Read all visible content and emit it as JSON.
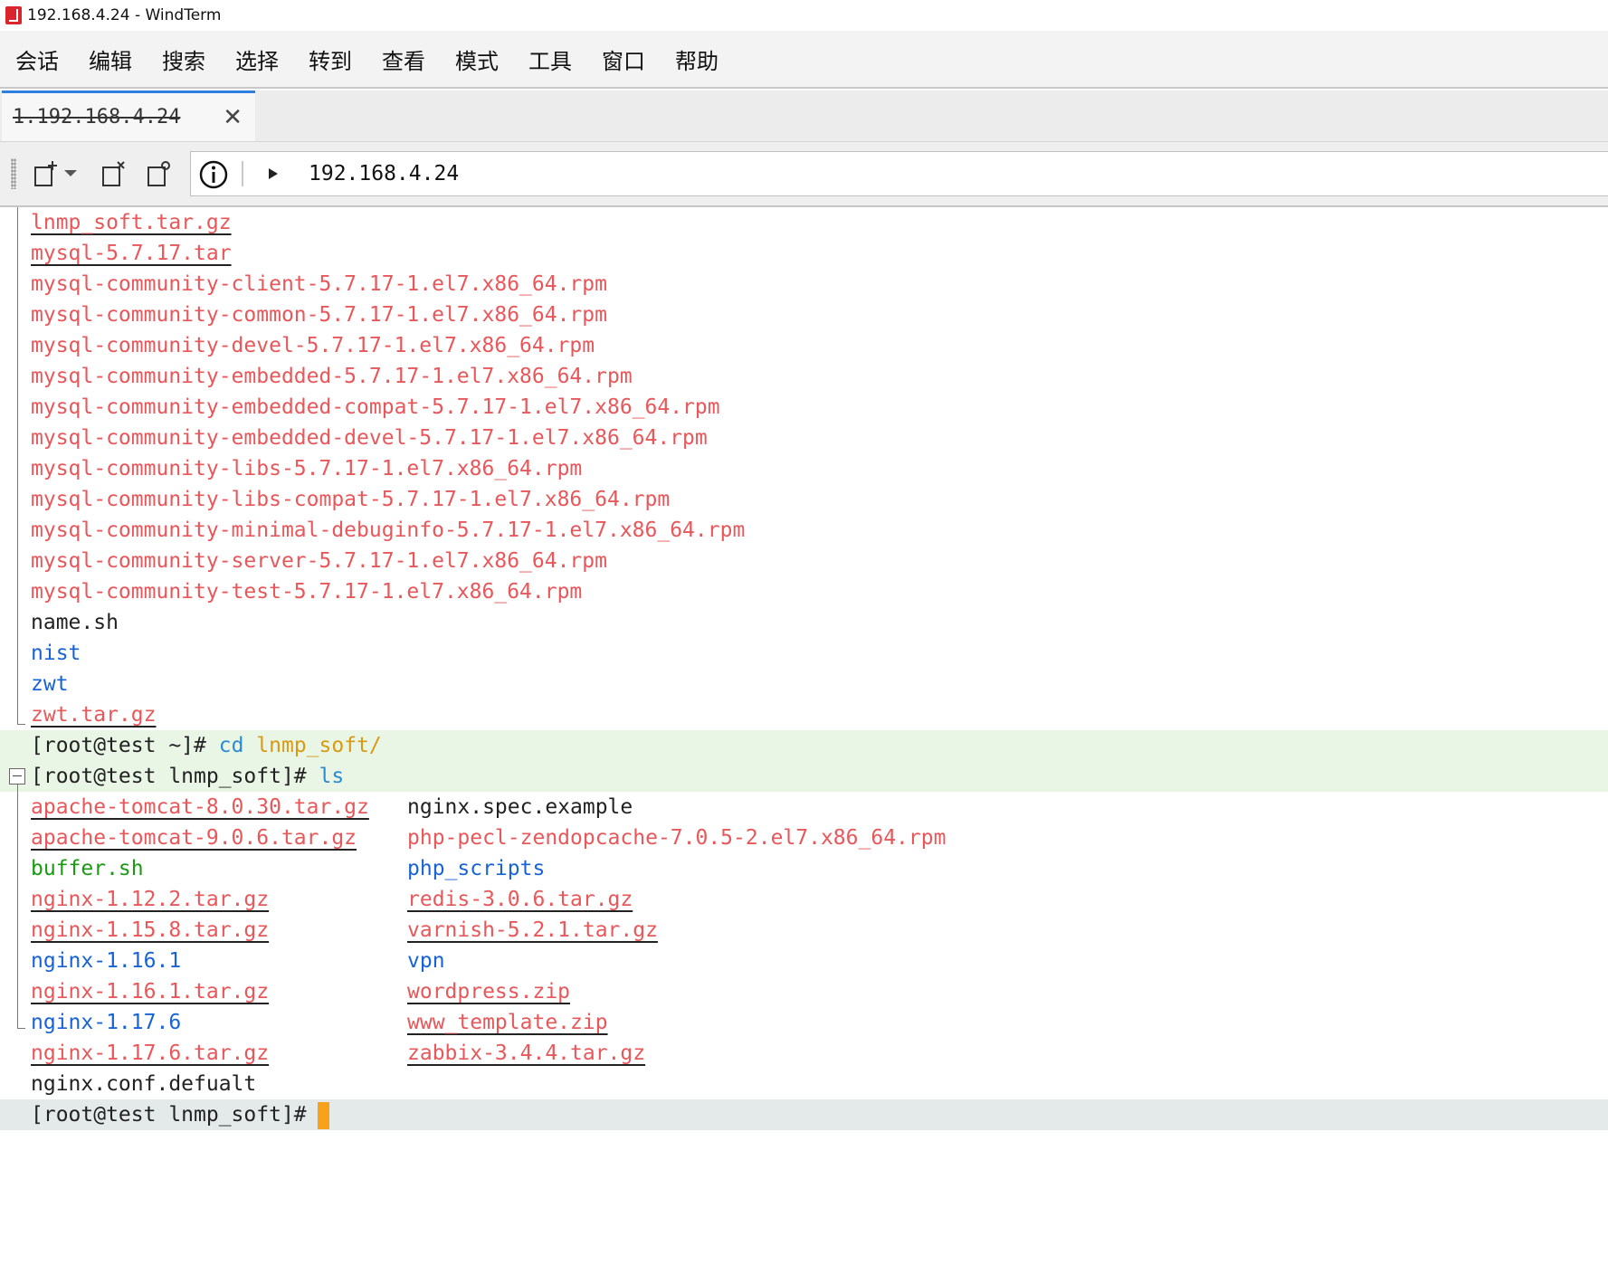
{
  "window": {
    "title": "192.168.4.24 - WindTerm"
  },
  "menu": [
    "会话",
    "编辑",
    "搜索",
    "选择",
    "转到",
    "查看",
    "模式",
    "工具",
    "窗口",
    "帮助"
  ],
  "tab": {
    "label": "1.192.168.4.24"
  },
  "toolbar": {
    "address": "192.168.4.24"
  },
  "icons": [
    "new-session-icon",
    "dropdown-arrow-icon",
    "close-session-icon",
    "session-settings-icon",
    "info-icon",
    "play-icon"
  ],
  "colors": {
    "archive": "#e8575a",
    "directory": "#1763d6",
    "executable": "#1a9a12",
    "accent_tab": "#2f7fe0",
    "cursor": "#f7a21a"
  },
  "terminal": {
    "listing1": [
      "lnmp_soft.tar.gz",
      "mysql-5.7.17.tar",
      "mysql-community-client-5.7.17-1.el7.x86_64.rpm",
      "mysql-community-common-5.7.17-1.el7.x86_64.rpm",
      "mysql-community-devel-5.7.17-1.el7.x86_64.rpm",
      "mysql-community-embedded-5.7.17-1.el7.x86_64.rpm",
      "mysql-community-embedded-compat-5.7.17-1.el7.x86_64.rpm",
      "mysql-community-embedded-devel-5.7.17-1.el7.x86_64.rpm",
      "mysql-community-libs-5.7.17-1.el7.x86_64.rpm",
      "mysql-community-libs-compat-5.7.17-1.el7.x86_64.rpm",
      "mysql-community-minimal-debuginfo-5.7.17-1.el7.x86_64.rpm",
      "mysql-community-server-5.7.17-1.el7.x86_64.rpm",
      "mysql-community-test-5.7.17-1.el7.x86_64.rpm",
      "name.sh",
      "nist",
      "zwt",
      "zwt.tar.gz"
    ],
    "prompt1": {
      "prompt": "[root@test ~]#",
      "command": "cd",
      "arg": "lnmp_soft/"
    },
    "prompt2": {
      "prompt": "[root@test lnmp_soft]#",
      "command": "ls"
    },
    "listing2_col1": [
      "apache-tomcat-8.0.30.tar.gz",
      "apache-tomcat-9.0.6.tar.gz",
      "buffer.sh",
      "nginx-1.12.2.tar.gz",
      "nginx-1.15.8.tar.gz",
      "nginx-1.16.1",
      "nginx-1.16.1.tar.gz",
      "nginx-1.17.6",
      "nginx-1.17.6.tar.gz",
      "nginx.conf.defualt"
    ],
    "listing2_col2": [
      "nginx.spec.example",
      "php-pecl-zendopcache-7.0.5-2.el7.x86_64.rpm",
      "php_scripts",
      "redis-3.0.6.tar.gz",
      "varnish-5.2.1.tar.gz",
      "vpn",
      "wordpress.zip",
      "www_template.zip",
      "zabbix-3.4.4.tar.gz"
    ],
    "prompt3": {
      "prompt": "[root@test lnmp_soft]#"
    }
  }
}
